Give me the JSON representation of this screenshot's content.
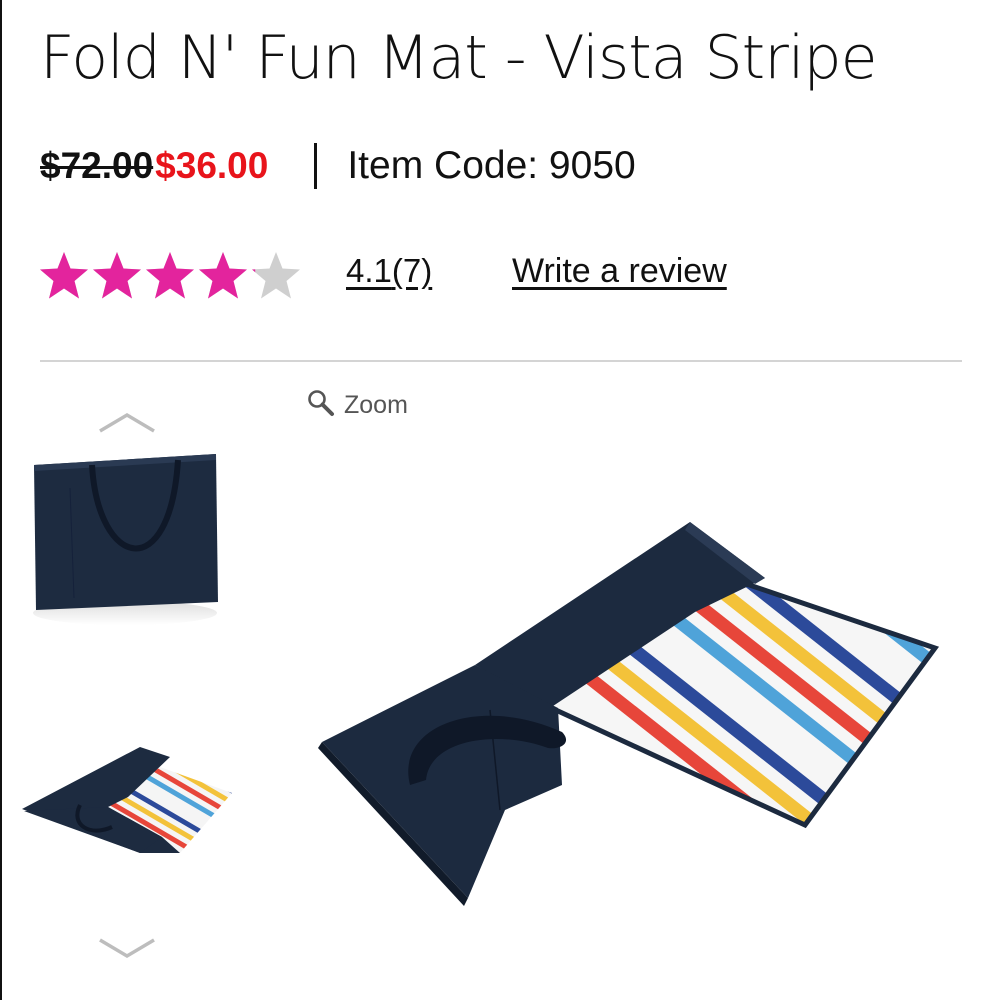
{
  "product": {
    "title": "Fold N' Fun Mat - Vista Stripe",
    "old_price": "$72.00",
    "sale_price": "$36.00",
    "item_code_label": "Item Code: 9050"
  },
  "rating": {
    "value": 4.1,
    "max": 5,
    "rating_text": "4.1",
    "count_text": "(7)",
    "write_review": "Write a review"
  },
  "gallery": {
    "zoom_label": "Zoom",
    "icons": {
      "zoom": "magnifier-icon",
      "prev": "chevron-up-icon",
      "next": "chevron-down-icon"
    },
    "thumbnails": [
      "folded-tote-view",
      "unfolded-mat-view"
    ]
  },
  "colors": {
    "star_filled": "#e3249d",
    "star_empty": "#cfcfcf",
    "sale_price": "#e8141b",
    "mat_navy": "#1c2a3f"
  }
}
